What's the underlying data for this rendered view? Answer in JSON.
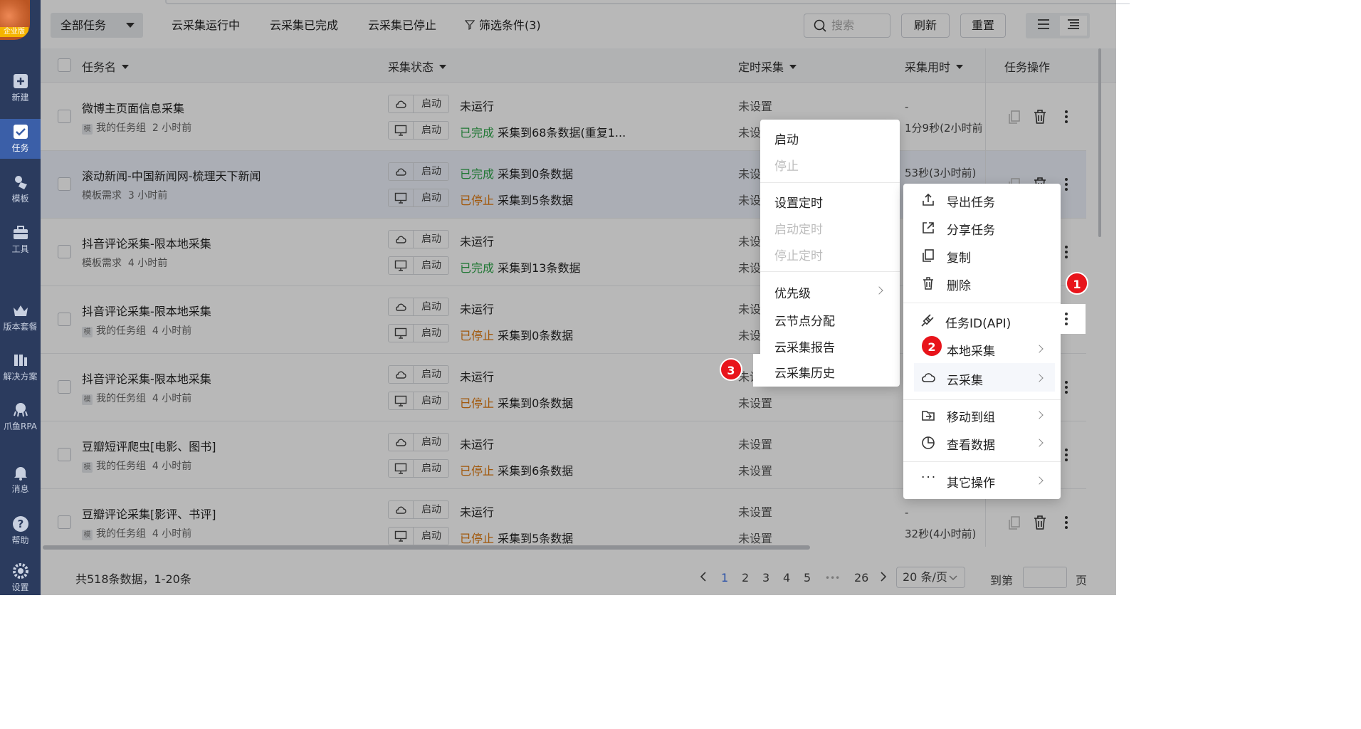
{
  "app": {
    "edition_badge": "企业版"
  },
  "sidebar": {
    "items": [
      {
        "label": "新建",
        "icon": "plus-square-icon"
      },
      {
        "label": "任务",
        "icon": "task-icon",
        "active": true
      },
      {
        "label": "模板",
        "icon": "template-icon"
      },
      {
        "label": "工具",
        "icon": "toolbox-icon"
      },
      {
        "label": "版本套餐",
        "icon": "crown-icon"
      },
      {
        "label": "解决方案",
        "icon": "solution-icon"
      },
      {
        "label": "爪鱼RPA",
        "icon": "octopus-icon"
      },
      {
        "label": "消息",
        "icon": "bell-icon"
      },
      {
        "label": "帮助",
        "icon": "help-icon"
      },
      {
        "label": "设置",
        "icon": "gear-icon"
      }
    ]
  },
  "toolbar": {
    "filter_dropdown": "全部任务",
    "filter_running": "云采集运行中",
    "filter_done": "云采集已完成",
    "filter_stopped": "云采集已停止",
    "filter_conditions": "筛选条件(3)",
    "search_placeholder": "搜索",
    "refresh": "刷新",
    "reset": "重置"
  },
  "table": {
    "columns": {
      "name": "任务名",
      "status": "采集状态",
      "schedule": "定时采集",
      "duration": "采集用时",
      "actions": "任务操作"
    },
    "start_label": "启动",
    "rows": [
      {
        "name": "微博主页面信息采集",
        "template_badge": "模",
        "group": "我的任务组",
        "time": "2 小时前",
        "cloud_state": "未运行",
        "cloud_detail": "",
        "local_state": "已完成",
        "local_detail": "采集到68条数据(重复1...",
        "sched1": "未设置",
        "sched2": "未设",
        "dur1": "-",
        "dur2": "1分9秒(2小时前"
      },
      {
        "name": "滚动新闻-中国新闻网-梳理天下新闻",
        "template_badge": "",
        "group": "模板需求",
        "time": "3 小时前",
        "cloud_state": "已完成",
        "cloud_detail": "采集到0条数据",
        "local_state": "已停止",
        "local_detail": "采集到5条数据",
        "sched1": "未设",
        "sched2": "未设",
        "dur1": "53秒(3小时前)",
        "dur2": ""
      },
      {
        "name": "抖音评论采集-限本地采集",
        "template_badge": "",
        "group": "模板需求",
        "time": "4 小时前",
        "cloud_state": "未运行",
        "cloud_detail": "",
        "local_state": "已完成",
        "local_detail": "采集到13条数据",
        "sched1": "未设",
        "sched2": "未设",
        "dur1": "",
        "dur2": ""
      },
      {
        "name": "抖音评论采集-限本地采集",
        "template_badge": "模",
        "group": "我的任务组",
        "time": "4 小时前",
        "cloud_state": "未运行",
        "cloud_detail": "",
        "local_state": "已停止",
        "local_detail": "采集到0条数据",
        "sched1": "未设",
        "sched2": "未设",
        "dur1": "",
        "dur2": ""
      },
      {
        "name": "抖音评论采集-限本地采集",
        "template_badge": "模",
        "group": "我的任务组",
        "time": "4 小时前",
        "cloud_state": "未运行",
        "cloud_detail": "",
        "local_state": "已停止",
        "local_detail": "采集到0条数据",
        "sched1": "未设",
        "sched2": "未设置",
        "dur1": "",
        "dur2": ""
      },
      {
        "name": "豆瓣短评爬虫[电影、图书]",
        "template_badge": "模",
        "group": "我的任务组",
        "time": "4 小时前",
        "cloud_state": "未运行",
        "cloud_detail": "",
        "local_state": "已停止",
        "local_detail": "采集到6条数据",
        "sched1": "未设置",
        "sched2": "未设置",
        "dur1": "",
        "dur2": ""
      },
      {
        "name": "豆瓣评论采集[影评、书评]",
        "template_badge": "模",
        "group": "我的任务组",
        "time": "4 小时前",
        "cloud_state": "未运行",
        "cloud_detail": "",
        "local_state": "已停止",
        "local_detail": "采集到5条数据",
        "sched1": "未设置",
        "sched2": "未设置",
        "dur1": "-",
        "dur2": "32秒(4小时前)"
      }
    ]
  },
  "footer": {
    "total": "共518条数据，1-20条",
    "pages": [
      "1",
      "2",
      "3",
      "4",
      "5",
      "•••",
      "26"
    ],
    "per_page": "20 条/页",
    "goto_label": "到第",
    "page_suffix": "页"
  },
  "cloud_submenu": {
    "items": [
      "启动",
      "停止",
      "设置定时",
      "启动定时",
      "停止定时",
      "优先级",
      "云节点分配",
      "云采集报告",
      "云采集历史"
    ]
  },
  "task_menu": {
    "items": [
      "导出任务",
      "分享任务",
      "复制",
      "删除",
      "任务ID(API)",
      "本地采集",
      "云采集",
      "移动到组",
      "查看数据",
      "其它操作"
    ]
  },
  "callouts": [
    "1",
    "2",
    "3"
  ],
  "colors": {
    "sidebar": "#2b3b5e",
    "active_nav": "#3b5fa8",
    "completed": "#2fa64a",
    "stopped": "#e07a10",
    "badge": "#e8141b",
    "page_current": "#3a6ee8"
  }
}
